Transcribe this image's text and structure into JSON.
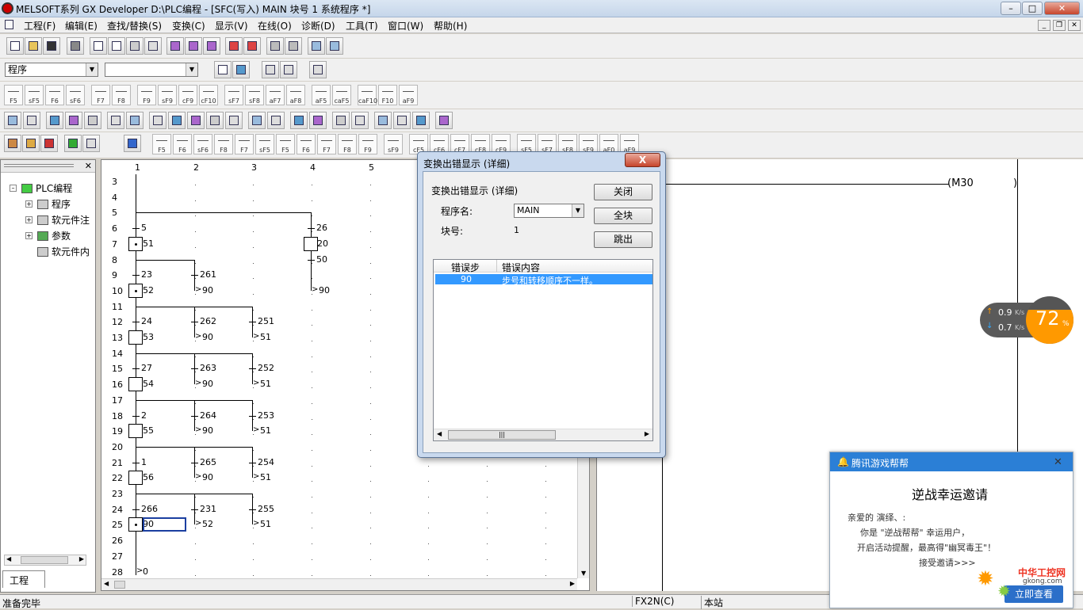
{
  "window": {
    "title": "MELSOFT系列 GX Developer D:\\PLC编程 - [SFC(写入)    MAIN    块号   1  系统程序  *]",
    "min": "–",
    "max": "□",
    "close": "✕"
  },
  "menu": [
    "工程(F)",
    "编辑(E)",
    "查找/替换(S)",
    "变换(C)",
    "显示(V)",
    "在线(O)",
    "诊断(D)",
    "工具(T)",
    "窗口(W)",
    "帮助(H)"
  ],
  "mdi": {
    "min": "_",
    "restore": "❐",
    "close": "✕"
  },
  "combos": {
    "left": "程序",
    "right": ""
  },
  "fkeys_row1": [
    "F5",
    "sF5",
    "F6",
    "sF6",
    "F7",
    "F8",
    "F9",
    "sF9",
    "cF9",
    "cF10",
    "sF7",
    "sF8",
    "aF7",
    "aF8",
    "aF5",
    "caF5",
    "caF10",
    "F10",
    "aF9"
  ],
  "fkeys_row4": [
    "F5",
    "F6",
    "sF6",
    "F8",
    "F7",
    "sF5",
    "F5",
    "F6",
    "F7",
    "F8",
    "F9",
    "sF9",
    "cF5",
    "cF6",
    "cF7",
    "cF8",
    "cF9",
    "sF5",
    "sF7",
    "sF8",
    "sF9",
    "aF0",
    "aF9"
  ],
  "tree": {
    "root": "PLC编程",
    "items": [
      "程序",
      "软元件注",
      "参数",
      "软元件内"
    ],
    "tab": "工程"
  },
  "columns": [
    "1",
    "2",
    "3",
    "4",
    "5"
  ],
  "rows": [
    "3",
    "4",
    "5",
    "6",
    "7",
    "8",
    "9",
    "10",
    "11",
    "12",
    "13",
    "14",
    "15",
    "16",
    "17",
    "18",
    "19",
    "20",
    "21",
    "22",
    "23",
    "24",
    "25",
    "26",
    "27",
    "28"
  ],
  "sfc": {
    "r6": [
      "5",
      "26"
    ],
    "r7": [
      "51",
      "20"
    ],
    "r8": [
      "50"
    ],
    "r9": [
      "23",
      "261"
    ],
    "r10": [
      "52",
      "90",
      "90"
    ],
    "r12": [
      "24",
      "262",
      "251"
    ],
    "r13": [
      "53",
      "90",
      "51"
    ],
    "r15": [
      "27",
      "263",
      "252"
    ],
    "r16": [
      "54",
      "90",
      "51"
    ],
    "r18": [
      "2",
      "264",
      "253"
    ],
    "r19": [
      "55",
      "90",
      "51"
    ],
    "r21": [
      "1",
      "265",
      "254"
    ],
    "r22": [
      "56",
      "90",
      "51"
    ],
    "r24": [
      "266",
      "231",
      "255"
    ],
    "r25": [
      "90",
      "52",
      "51"
    ],
    "r28": [
      "0"
    ]
  },
  "ladder": {
    "coil": "(M30",
    "coil_end": ")"
  },
  "dialog": {
    "title": "变换出错显示 (详细)",
    "close": "X",
    "heading": "变换出错显示 (详细)",
    "program_label": "程序名:",
    "program_value": "MAIN",
    "block_label": "块号:",
    "block_value": "1",
    "buttons": {
      "close": "关闭",
      "all": "全块",
      "jump": "跳出"
    },
    "columns": [
      "错误步",
      "错误内容"
    ],
    "rows": [
      {
        "step": "90",
        "content": "步号和转移顺序不一样。"
      }
    ]
  },
  "speed": {
    "up": "0.9",
    "down": "0.7",
    "unit": "K/s",
    "percent": "72",
    "pct_sign": "%"
  },
  "qq": {
    "title": "腾讯游戏帮帮",
    "close": "✕",
    "headline": "逆战幸运邀请",
    "greeting": "亲爱的 演绎、:",
    "line1": "你是 \"逆战帮帮\" 幸运用户，",
    "line2": "开启活动提醒，最高得\"幽冥毒王\"！",
    "link": "接受邀请>>>",
    "button": "立即查看"
  },
  "watermark": {
    "text": "中华工控网",
    "sub": "gkong.com"
  },
  "status": {
    "left": "准备完毕",
    "plc": "FX2N(C)",
    "station": "本站"
  }
}
